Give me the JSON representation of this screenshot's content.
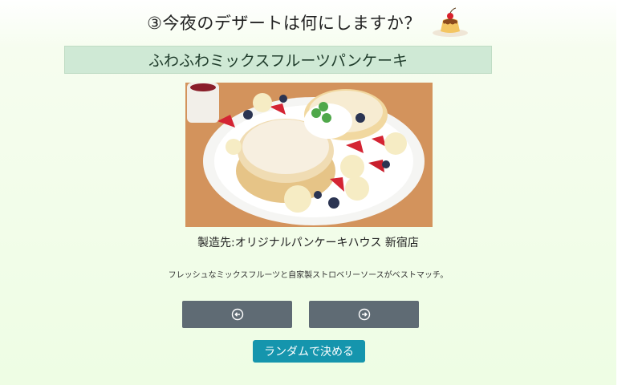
{
  "header": {
    "title": "③今夜のデザートは何にしますか？"
  },
  "dessert": {
    "name": "ふわふわミックスフルーツパンケーキ",
    "maker": "製造先:オリジナルパンケーキハウス 新宿店",
    "description": "フレッシュなミックスフルーツと自家製ストロベリーソースがベストマッチ。",
    "image_alt": "ふわふわミックスフルーツパンケーキ"
  },
  "controls": {
    "prev_icon": "arrow-left-circle-icon",
    "next_icon": "arrow-right-circle-icon",
    "random_label": "ランダムで決める"
  },
  "colors": {
    "name_bar": "#cfe9d5",
    "nav_button": "#5f6b74",
    "random_button": "#1595ad"
  }
}
